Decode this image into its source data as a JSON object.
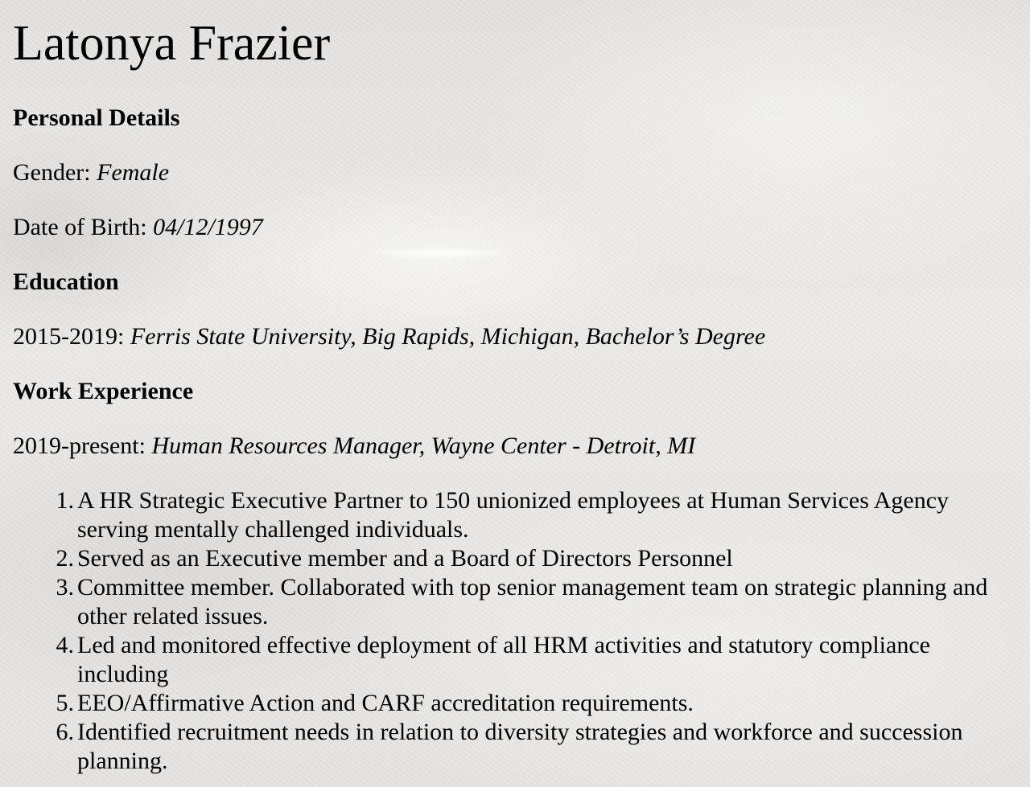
{
  "resume": {
    "name": "Latonya Frazier",
    "personal_details": {
      "heading": "Personal Details",
      "gender_label": "Gender:",
      "gender_value": "Female",
      "dob_label": "Date of Birth:",
      "dob_value": "04/12/1997"
    },
    "education": {
      "heading": "Education",
      "entries": [
        {
          "period": "2015-2019:",
          "detail": "Ferris State University, Big Rapids, Michigan, Bachelor’s Degree"
        }
      ]
    },
    "work_experience": {
      "heading": "Work Experience",
      "entries": [
        {
          "period": "2019-present:",
          "title_org": "Human Resources Manager, Wayne Center",
          "separator": "-",
          "location": "Detroit, MI",
          "duties": [
            {
              "num": "1.",
              "text": "A HR Strategic Executive Partner to 150 unionized employees at Human Services Agency serving mentally challenged individuals."
            },
            {
              "num": "2.",
              "text": "Served as an Executive member and a Board of Directors Personnel"
            },
            {
              "num": "3.",
              "text": "Committee member. Collaborated with top senior management team on strategic planning and other related issues."
            },
            {
              "num": "4.",
              "text": "Led and monitored effective deployment of all HRM activities and statutory compliance including"
            },
            {
              "num": "5.",
              "text": "EEO/Affirmative Action and CARF accreditation requirements."
            },
            {
              "num": "6.",
              "text": "Identified recruitment needs in relation to diversity strategies and workforce and succession planning."
            }
          ]
        }
      ]
    }
  }
}
